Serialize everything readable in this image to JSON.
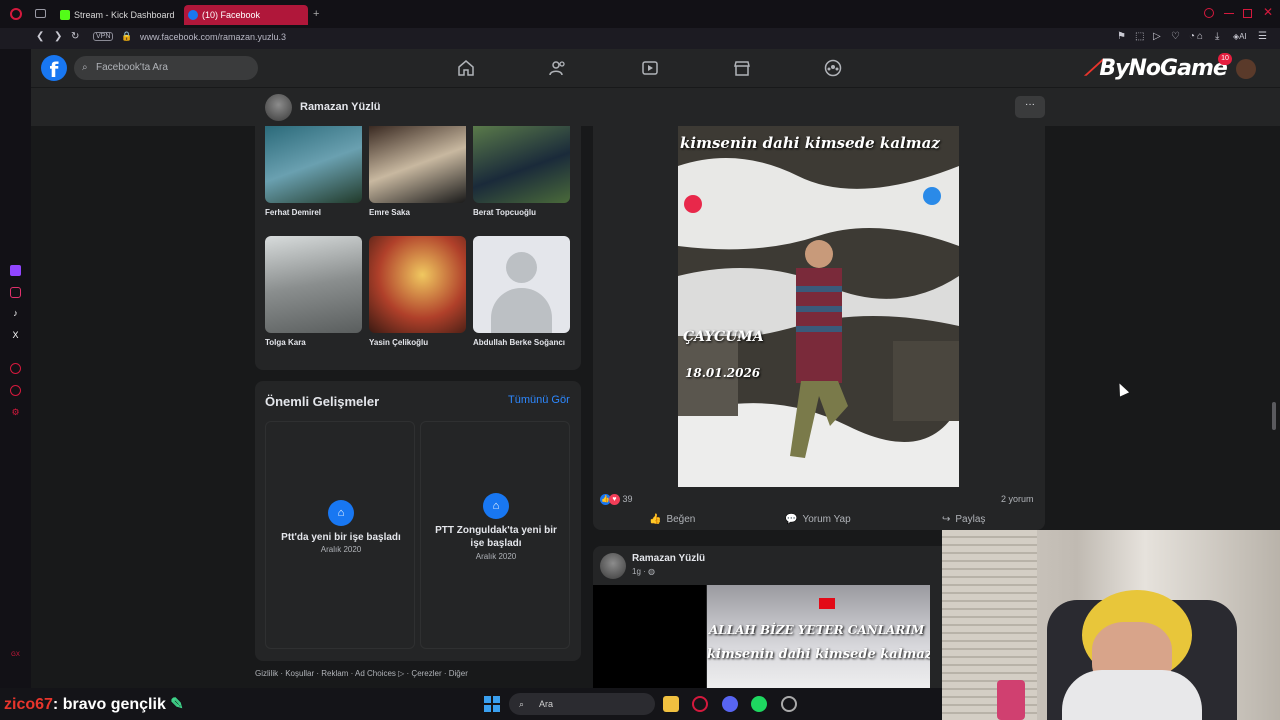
{
  "browser": {
    "tabs": [
      {
        "label": "Stream - Kick Dashboard",
        "active": false
      },
      {
        "label": "(10) Facebook",
        "active": true
      }
    ],
    "new_tab": "+",
    "vpn_label": "VPN",
    "url": "www.facebook.com/ramazan.yuzlu.3",
    "ai_label": "AI"
  },
  "facebook": {
    "logo": "f",
    "search_placeholder": "Facebook'ta Ara",
    "notification_count": "10",
    "brand_overlay": "ByNoGame",
    "profile_name": "Ramazan Yüzlü",
    "more": "···"
  },
  "friends": [
    {
      "name": "Ferhat Demirel"
    },
    {
      "name": "Emre Saka"
    },
    {
      "name": "Berat Topcuoğlu"
    },
    {
      "name": "Tolga Kara"
    },
    {
      "name": "Yasin Çelikoğlu"
    },
    {
      "name": "Abdullah Berke Soğancı"
    }
  ],
  "events": {
    "title": "Önemli Gelişmeler",
    "see_all": "Tümünü Gör",
    "items": [
      {
        "title": "Ptt'da yeni bir işe başladı",
        "date": "Aralık 2020"
      },
      {
        "title": "PTT Zonguldak'ta yeni bir işe başladı",
        "date": "Aralık 2020"
      }
    ]
  },
  "footer": "Gizlilik · Koşullar · Reklam · Ad Choices ▷ · Çerezler · Diğer",
  "post1": {
    "image_text_top": "kimsenin dahi kimsede kalmaz",
    "image_place": "ÇAYCUMA",
    "image_date": "18.01.2026",
    "reaction_count": "39",
    "comments": "2 yorum",
    "like": "Beğen",
    "comment": "Yorum Yap",
    "share": "Paylaş"
  },
  "post2": {
    "author": "Ramazan Yüzlü",
    "time": "1g ·",
    "image_text1": "ALLAH BİZE YETER CANLARIM",
    "image_text2": "kimsenin dahi kimsede kalmaz"
  },
  "chat": {
    "user": "zico67",
    "message": ": bravo gençlik"
  },
  "taskbar": {
    "search": "Ara"
  },
  "colors": {
    "fb_blue": "#1877f2",
    "accent_tab": "#b0173a",
    "link": "#2d88ff"
  }
}
